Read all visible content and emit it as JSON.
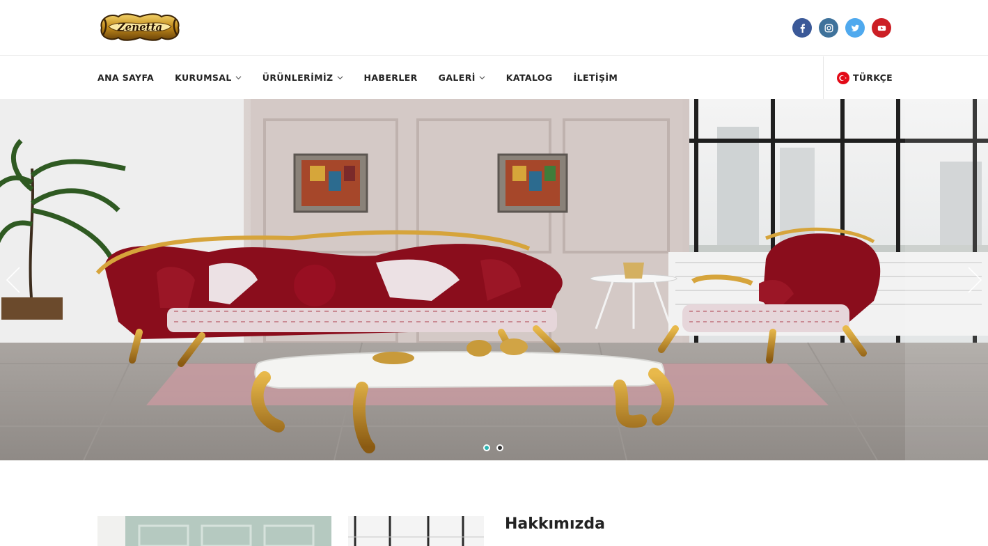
{
  "brand": {
    "logo_text": "Zenetta"
  },
  "social": [
    {
      "name": "facebook",
      "icon": "facebook-icon",
      "color": "#3b5998"
    },
    {
      "name": "instagram",
      "icon": "instagram-icon",
      "color": "#3f729b"
    },
    {
      "name": "twitter",
      "icon": "twitter-icon",
      "color": "#4fa9ee"
    },
    {
      "name": "youtube",
      "icon": "youtube-icon",
      "color": "#cc1f25"
    }
  ],
  "nav": {
    "items": [
      {
        "label": "ANA SAYFA",
        "dropdown": false
      },
      {
        "label": "KURUMSAL",
        "dropdown": true
      },
      {
        "label": "ÜRÜNLERİMİZ",
        "dropdown": true
      },
      {
        "label": "HABERLER",
        "dropdown": false
      },
      {
        "label": "GALERİ",
        "dropdown": true
      },
      {
        "label": "KATALOG",
        "dropdown": false
      },
      {
        "label": "İLETİŞİM",
        "dropdown": false
      }
    ],
    "language": {
      "label": "TÜRKÇE",
      "flag_icon": "turkey-flag-icon"
    }
  },
  "hero": {
    "slides_total": 2,
    "active_slide": 1,
    "accent_color": "#2bb3b1"
  },
  "about": {
    "title": "Hakkımızda"
  }
}
